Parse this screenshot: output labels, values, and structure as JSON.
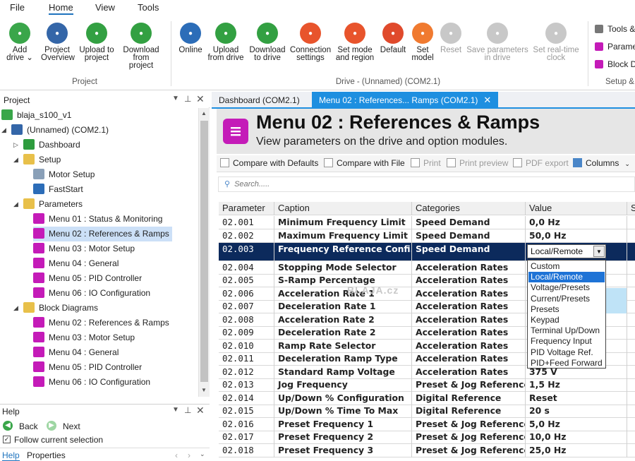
{
  "menubar": [
    "File",
    "Home",
    "View",
    "Tools"
  ],
  "ribbon": {
    "project_buttons": [
      {
        "label": "Add\ndrive ⌄",
        "icon": "add-drive-icon",
        "color": "#3aa64a"
      },
      {
        "label": "Project\nOverview",
        "icon": "project-overview-icon",
        "color": "#3466a8"
      },
      {
        "label": "Upload to\nproject",
        "icon": "upload-to-project-icon",
        "color": "#33a042"
      },
      {
        "label": "Download\nfrom project",
        "icon": "download-from-project-icon",
        "color": "#33a042"
      }
    ],
    "project_group": "Project",
    "drive_buttons": [
      {
        "label": "Online",
        "icon": "online-icon",
        "color": "#2c6db8",
        "disabled": false
      },
      {
        "label": "Upload\nfrom drive",
        "icon": "upload-from-drive-icon",
        "color": "#33a042",
        "disabled": false
      },
      {
        "label": "Download\nto drive",
        "icon": "download-to-drive-icon",
        "color": "#33a042",
        "disabled": false
      },
      {
        "label": "Connection\nsettings",
        "icon": "connection-settings-icon",
        "color": "#e8542c",
        "disabled": false
      },
      {
        "label": "Set mode\nand region",
        "icon": "set-mode-icon",
        "color": "#e8542c",
        "disabled": false
      },
      {
        "label": "Default",
        "icon": "default-icon",
        "color": "#e04a2c",
        "disabled": false
      },
      {
        "label": "Set\nmodel",
        "icon": "set-model-icon",
        "color": "#f07a30",
        "disabled": false
      },
      {
        "label": "Reset",
        "icon": "reset-icon",
        "color": "#c8c8c8",
        "disabled": true
      },
      {
        "label": "Save parameters\nin drive",
        "icon": "save-parameters-icon",
        "color": "#c8c8c8",
        "disabled": true
      },
      {
        "label": "Set real-time\nclock",
        "icon": "set-clock-icon",
        "color": "#c8c8c8",
        "disabled": true
      }
    ],
    "drive_group": "Drive - (Unnamed) (COM2.1)",
    "side_buttons": [
      {
        "label": "Tools &",
        "icon": "tools-gear-icon",
        "color": "#777777"
      },
      {
        "label": "Parame",
        "icon": "parameters-icon",
        "color": "#c41bb8"
      },
      {
        "label": "Block D",
        "icon": "block-diagram-icon",
        "color": "#c41bb8"
      }
    ],
    "side_group": "Setup &"
  },
  "project_panel": {
    "title": "Project",
    "tree": [
      {
        "label": "blaja_s100_v1",
        "indent": 0,
        "icon": "project-root-icon",
        "color": "#3aa64a",
        "caret": "",
        "selected": false
      },
      {
        "label": "(Unnamed) (COM2.1)",
        "indent": 1,
        "icon": "drive-icon",
        "color": "#3466a8",
        "caret": "◢",
        "selected": false
      },
      {
        "label": "Dashboard",
        "indent": 2,
        "icon": "home-icon",
        "color": "#2e9c3e",
        "caret": "▷",
        "selected": false
      },
      {
        "label": "Setup",
        "indent": 2,
        "icon": "folder-icon",
        "color": "#e8c04a",
        "caret": "◢",
        "selected": false
      },
      {
        "label": "Motor Setup",
        "indent": 3,
        "icon": "motor-setup-icon",
        "color": "#8aa0b8",
        "caret": "",
        "selected": false
      },
      {
        "label": "FastStart",
        "indent": 3,
        "icon": "faststart-icon",
        "color": "#2c6db8",
        "caret": "",
        "selected": false
      },
      {
        "label": "Parameters",
        "indent": 2,
        "icon": "folder-icon",
        "color": "#e8c04a",
        "caret": "◢",
        "selected": false
      },
      {
        "label": "Menu 01 : Status & Monitoring",
        "indent": 3,
        "icon": "menu-icon",
        "color": "#c41bb8",
        "caret": "",
        "selected": false
      },
      {
        "label": "Menu 02 : References & Ramps",
        "indent": 3,
        "icon": "menu-icon",
        "color": "#c41bb8",
        "caret": "",
        "selected": true
      },
      {
        "label": "Menu 03 : Motor Setup",
        "indent": 3,
        "icon": "menu-icon",
        "color": "#c41bb8",
        "caret": "",
        "selected": false
      },
      {
        "label": "Menu 04 : General",
        "indent": 3,
        "icon": "menu-icon",
        "color": "#c41bb8",
        "caret": "",
        "selected": false
      },
      {
        "label": "Menu 05 : PID Controller",
        "indent": 3,
        "icon": "menu-icon",
        "color": "#c41bb8",
        "caret": "",
        "selected": false
      },
      {
        "label": "Menu 06 : IO Configuration",
        "indent": 3,
        "icon": "menu-icon",
        "color": "#c41bb8",
        "caret": "",
        "selected": false
      },
      {
        "label": "Block Diagrams",
        "indent": 2,
        "icon": "folder-icon",
        "color": "#e8c04a",
        "caret": "◢",
        "selected": false
      },
      {
        "label": "Menu 02 : References & Ramps",
        "indent": 3,
        "icon": "block-diagram-icon",
        "color": "#c41bb8",
        "caret": "",
        "selected": false
      },
      {
        "label": "Menu 03 : Motor Setup",
        "indent": 3,
        "icon": "block-diagram-icon",
        "color": "#c41bb8",
        "caret": "",
        "selected": false
      },
      {
        "label": "Menu 04 : General",
        "indent": 3,
        "icon": "block-diagram-icon",
        "color": "#c41bb8",
        "caret": "",
        "selected": false
      },
      {
        "label": "Menu 05 : PID Controller",
        "indent": 3,
        "icon": "block-diagram-icon",
        "color": "#c41bb8",
        "caret": "",
        "selected": false
      },
      {
        "label": "Menu 06 : IO Configuration",
        "indent": 3,
        "icon": "block-diagram-icon",
        "color": "#c41bb8",
        "caret": "",
        "selected": false
      }
    ]
  },
  "help_panel": {
    "title": "Help",
    "back": "Back",
    "next": "Next",
    "follow": "Follow current selection",
    "tabs": [
      "Help",
      "Properties"
    ]
  },
  "tabs": [
    {
      "label": "Dashboard (COM2.1)",
      "active": false
    },
    {
      "label": "Menu 02 : References... Ramps (COM2.1)",
      "active": true
    }
  ],
  "header": {
    "title": "Menu 02 : References & Ramps",
    "subtitle": "View parameters on the drive and option modules."
  },
  "toolbar": {
    "compare_defaults": "Compare with Defaults",
    "compare_file": "Compare with File",
    "print": "Print",
    "print_preview": "Print preview",
    "pdf_export": "PDF export",
    "columns": "Columns"
  },
  "search": {
    "placeholder": "Search....."
  },
  "grid": {
    "columns": [
      "Parameter",
      "Caption",
      "Categories",
      "Value",
      "S"
    ],
    "rows": [
      {
        "parameter": "02.001",
        "caption": "Minimum Frequency Limit",
        "category": "Speed Demand",
        "value": "0,0 Hz"
      },
      {
        "parameter": "02.002",
        "caption": "Maximum Frequency Limit",
        "category": "Speed Demand",
        "value": "50,0 Hz"
      },
      {
        "parameter": "02.003",
        "caption": "Frequency Reference Confi...",
        "category": "Speed Demand",
        "value": ""
      },
      {
        "parameter": "02.004",
        "caption": "Stopping Mode Selector",
        "category": "Acceleration Rates",
        "value": ""
      },
      {
        "parameter": "02.005",
        "caption": "S-Ramp Percentage",
        "category": "Acceleration Rates",
        "value": ""
      },
      {
        "parameter": "02.006",
        "caption": "Acceleration Rate 1",
        "category": "Acceleration Rates",
        "value": ""
      },
      {
        "parameter": "02.007",
        "caption": "Deceleration Rate 1",
        "category": "Acceleration Rates",
        "value": ""
      },
      {
        "parameter": "02.008",
        "caption": "Acceleration Rate 2",
        "category": "Acceleration Rates",
        "value": ""
      },
      {
        "parameter": "02.009",
        "caption": "Deceleration Rate 2",
        "category": "Acceleration Rates",
        "value": ""
      },
      {
        "parameter": "02.010",
        "caption": "Ramp Rate Selector",
        "category": "Acceleration Rates",
        "value": ""
      },
      {
        "parameter": "02.011",
        "caption": "Deceleration Ramp Type",
        "category": "Acceleration Rates",
        "value": ""
      },
      {
        "parameter": "02.012",
        "caption": "Standard Ramp Voltage",
        "category": "Acceleration Rates",
        "value": "375 V"
      },
      {
        "parameter": "02.013",
        "caption": "Jog Frequency",
        "category": "Preset & Jog References",
        "value": "1,5 Hz"
      },
      {
        "parameter": "02.014",
        "caption": "Up/Down % Configuration",
        "category": "Digital Reference",
        "value": "Reset"
      },
      {
        "parameter": "02.015",
        "caption": "Up/Down % Time To Max",
        "category": "Digital Reference",
        "value": "20 s"
      },
      {
        "parameter": "02.016",
        "caption": "Preset Frequency 1",
        "category": "Preset & Jog References",
        "value": "5,0 Hz"
      },
      {
        "parameter": "02.017",
        "caption": "Preset Frequency 2",
        "category": "Preset & Jog References",
        "value": "10,0 Hz"
      },
      {
        "parameter": "02.018",
        "caption": "Preset Frequency 3",
        "category": "Preset & Jog References",
        "value": "25,0 Hz"
      }
    ],
    "selected_index": 2
  },
  "combo": {
    "value": "Local/Remote",
    "options": [
      "Custom",
      "Local/Remote",
      "Voltage/Presets",
      "Current/Presets",
      "Presets",
      "Keypad",
      "Terminal Up/Down",
      "Frequency Input",
      "PID Voltage Ref.",
      "PID+Feed Forward"
    ],
    "selected_option": 1
  },
  "watermark": "BLAJA.cz",
  "colors": {
    "accent": "#1e8fe0",
    "selected_row": "#0c2a5c",
    "menu_icon": "#c41bb8"
  }
}
